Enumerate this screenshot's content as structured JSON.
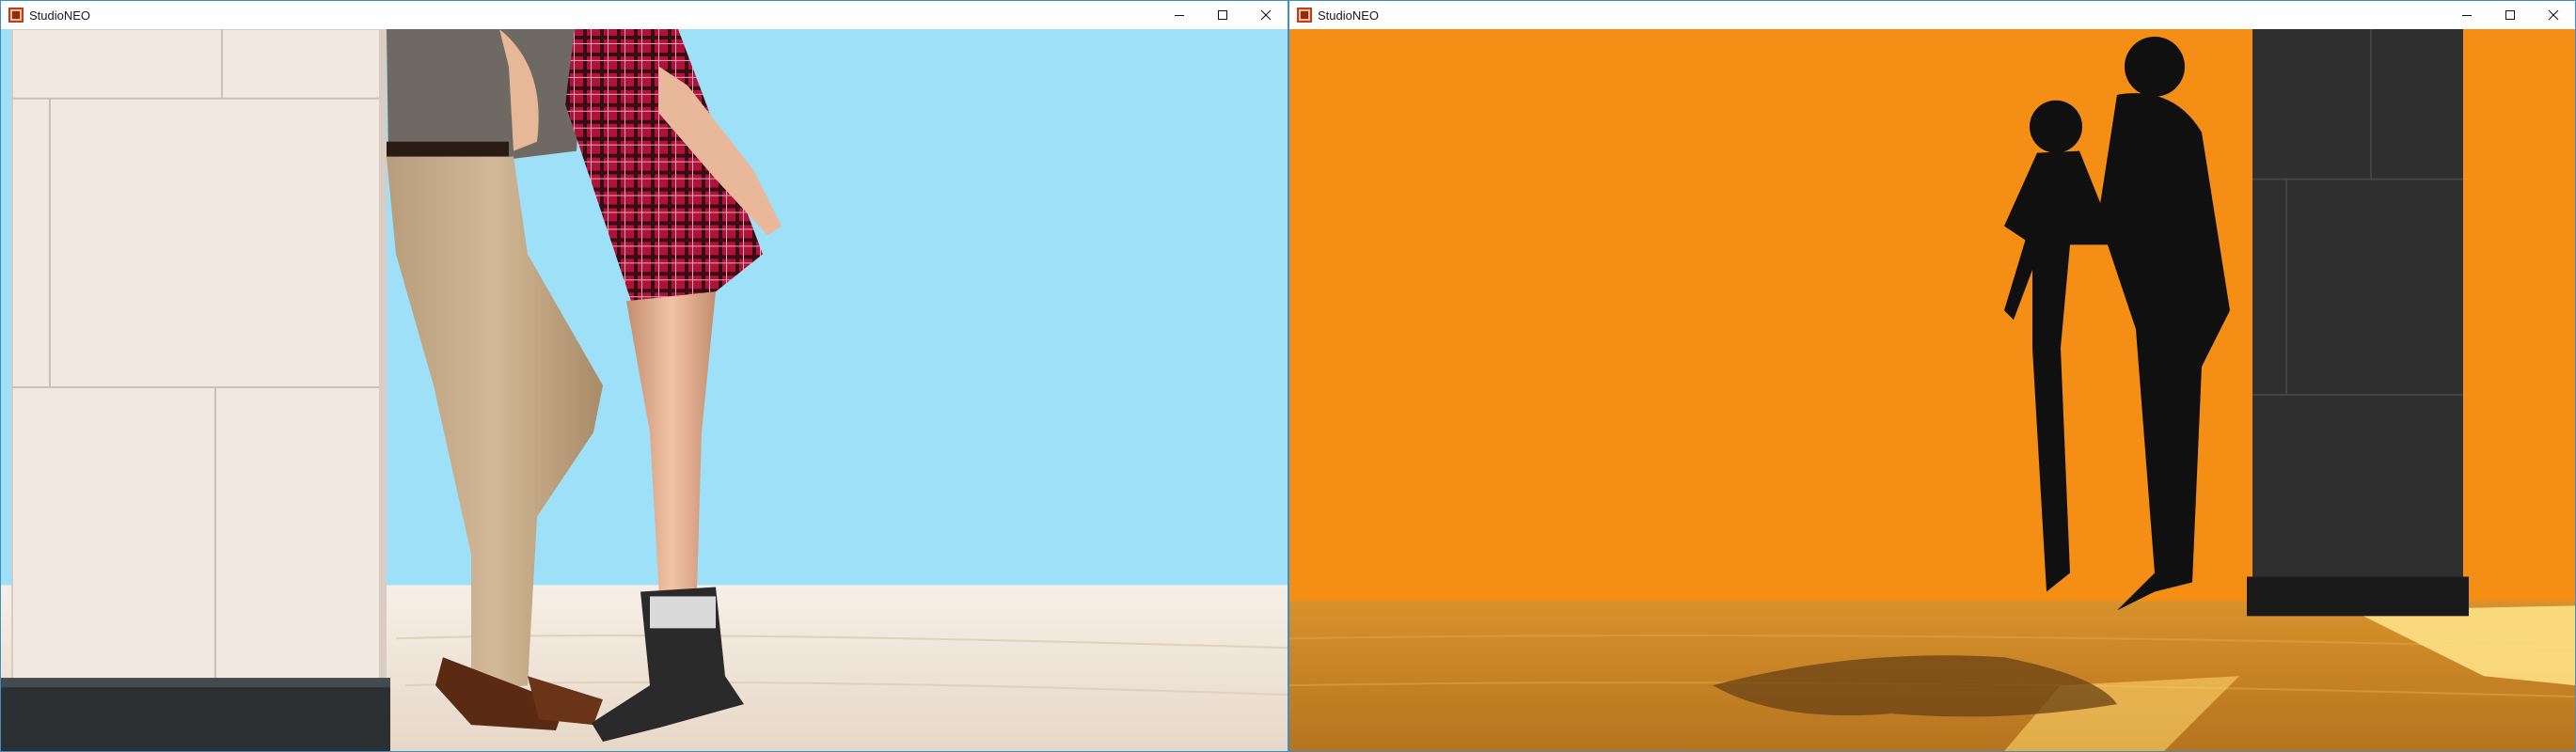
{
  "windows": [
    {
      "title": "StudioNEO",
      "icon": "studioneo-app-icon",
      "controls": [
        "minimize-icon",
        "maximize-icon",
        "close-icon"
      ],
      "scene": {
        "sky_color": "#9ee0f8",
        "floor_color": "#f2e8dc",
        "objects": [
          "marble-pillar",
          "man-figure",
          "woman-figure"
        ]
      }
    },
    {
      "title": "StudioNEO",
      "icon": "studioneo-app-icon",
      "controls": [
        "minimize-icon",
        "maximize-icon",
        "close-icon"
      ],
      "scene": {
        "sky_color": "#f48e14",
        "floor_color": "#c8862a",
        "objects": [
          "dark-pillar",
          "couple-silhouette",
          "ground-shadow"
        ]
      }
    }
  ]
}
